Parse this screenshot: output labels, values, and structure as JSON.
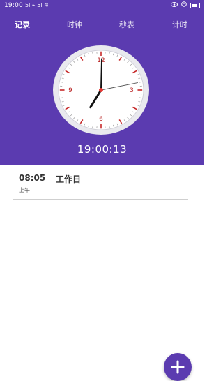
{
  "status_bar": {
    "time": "19:00",
    "left_icons": "5l ⌁ 5l ≋",
    "right_icons": [
      "eye-icon",
      "alarm-icon",
      "battery-icon"
    ]
  },
  "tabs": [
    {
      "label": "记录",
      "active": true
    },
    {
      "label": "时钟",
      "active": false
    },
    {
      "label": "秒表",
      "active": false
    },
    {
      "label": "计时",
      "active": false
    }
  ],
  "clock": {
    "numerals": [
      "12",
      "3",
      "6",
      "9"
    ],
    "hour": 19,
    "minute": 0,
    "second": 13
  },
  "digital_time": "19:00:13",
  "alarms": [
    {
      "time": "08:05",
      "period": "上午",
      "label": "工作日"
    }
  ],
  "fab": {
    "icon": "plus-icon"
  },
  "colors": {
    "primary": "#5b3bb0",
    "clock_ticks": "#c62828",
    "second_hand": "#e53935"
  }
}
